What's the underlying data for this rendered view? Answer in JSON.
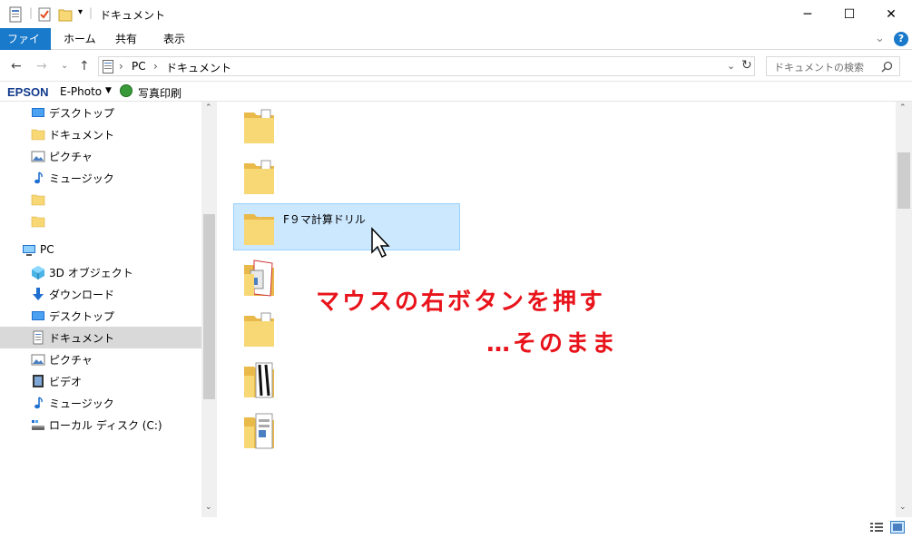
{
  "window": {
    "title": "ドキュメント",
    "controls": {
      "minimize": "─",
      "maximize": "☐",
      "close": "✕"
    }
  },
  "ribbon": {
    "tabs": [
      "ファイル",
      "ホーム",
      "共有",
      "表示"
    ],
    "expand_glyph": "⌄",
    "help_glyph": "?"
  },
  "address": {
    "breadcrumb": [
      "PC",
      "ドキュメント"
    ],
    "search_placeholder": "ドキュメントの検索"
  },
  "epson_bar": {
    "logo": "EPSON",
    "app": "E-Photo",
    "print_label": "写真印刷"
  },
  "nav": {
    "items": [
      {
        "label": "デスクトップ",
        "icon": "desktop-icon"
      },
      {
        "label": "ドキュメント",
        "icon": "folder-icon"
      },
      {
        "label": "ピクチャ",
        "icon": "pictures-icon"
      },
      {
        "label": "ミュージック",
        "icon": "music-icon"
      },
      {
        "label": "",
        "icon": "folder-icon"
      },
      {
        "label": "",
        "icon": "folder-icon"
      },
      {
        "label": "PC",
        "icon": "pc-icon"
      },
      {
        "label": "3D オブジェクト",
        "icon": "3d-objects-icon"
      },
      {
        "label": "ダウンロード",
        "icon": "download-icon"
      },
      {
        "label": "デスクトップ",
        "icon": "desktop-icon"
      },
      {
        "label": "ドキュメント",
        "icon": "documents-icon",
        "selected": true
      },
      {
        "label": "ピクチャ",
        "icon": "pictures-icon"
      },
      {
        "label": "ビデオ",
        "icon": "video-icon"
      },
      {
        "label": "ミュージック",
        "icon": "music-icon"
      },
      {
        "label": "ローカル ディスク (C:)",
        "icon": "drive-icon"
      }
    ]
  },
  "content": {
    "selected_folder_name": "F９マ計算ドリル"
  },
  "annotation": {
    "line1": "マウスの右ボタンを押す",
    "line2": "…そのまま"
  },
  "colors": {
    "accent": "#1979ca",
    "selection": "#cce8ff",
    "annotation": "#e8131b",
    "folder": "#f8d775"
  }
}
